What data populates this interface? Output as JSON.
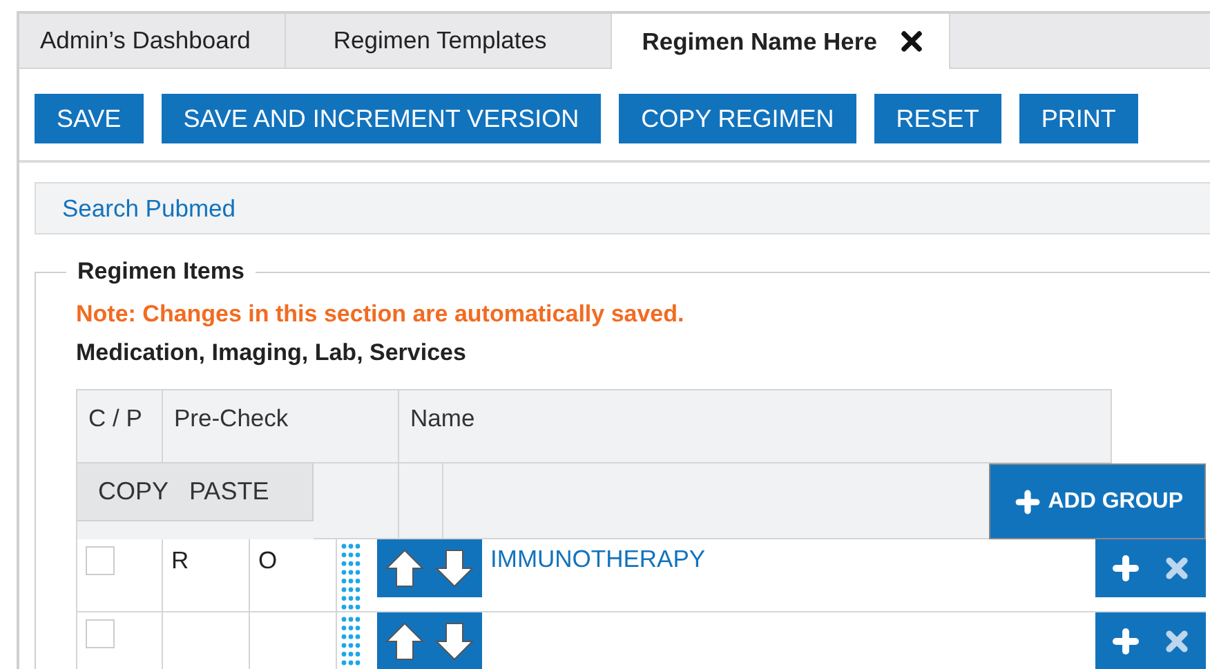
{
  "tabs": [
    {
      "label": "Admin’s Dashboard",
      "selected": false,
      "closable": false
    },
    {
      "label": "Regimen Templates",
      "selected": false,
      "closable": false
    },
    {
      "label": "Regimen Name Here",
      "selected": true,
      "closable": true
    }
  ],
  "toolbar": [
    "SAVE",
    "SAVE AND INCREMENT VERSION",
    "COPY REGIMEN",
    "RESET",
    "PRINT"
  ],
  "search_link": "Search Pubmed",
  "section": {
    "legend": "Regimen Items",
    "note": "Note: Changes in this section are automatically saved.",
    "subtitle": "Medication, Imaging, Lab, Services"
  },
  "table": {
    "columns": [
      "C / P",
      "Pre-Check",
      "Name"
    ],
    "copy": "COPY",
    "paste": "PASTE",
    "add_group": "ADD GROUP",
    "rows": [
      {
        "checked": false,
        "precheck_1": "R",
        "precheck_2": "O",
        "name": "IMMUNOTHERAPY"
      },
      {
        "checked": false
      }
    ]
  }
}
